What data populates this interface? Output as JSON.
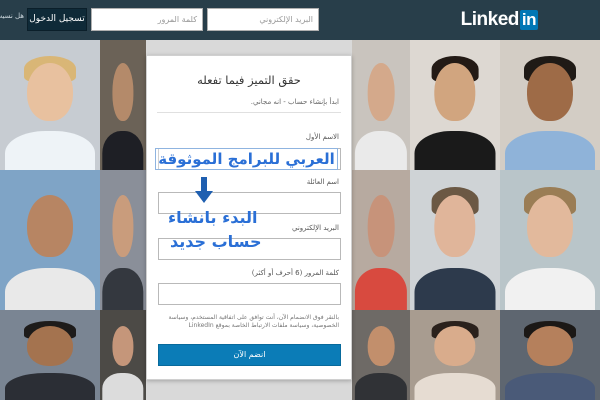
{
  "header": {
    "logo_text": "Linked",
    "logo_badge": "in",
    "email_placeholder": "البريد الإلكتروني",
    "password_placeholder": "كلمة المرور",
    "login_label": "تسجيل الدخول",
    "forgot_label": "هل نسيت"
  },
  "card": {
    "title": "حقق التميز فيما تفعله",
    "subtitle": "ابدأ بإنشاء حساب - انه مجاني.",
    "first_name_label": "الاسم الأول",
    "last_name_label": "اسم العائلة",
    "email_label": "البريد الإلكتروني",
    "password_label": "كلمة المرور (6 أحرف أو أكثر)",
    "terms_text": "بالنقر فوق الانضمام الآن، أنت توافق على اتفاقية المستخدم، وسياسة الخصوصية، وسياسة ملفات الارتباط الخاصة بموقع LinkedIn",
    "join_label": "انضم الآن"
  },
  "annotations": {
    "brand": "العربي للبرامج الموثوقة",
    "line1": "البدء بانشاء",
    "line2": "حساب جديد"
  },
  "colors": {
    "topbar": "#283e4a",
    "brand_blue": "#0077b5",
    "join_button": "#0b7cb7",
    "annotation_text": "#2a6fd6"
  }
}
